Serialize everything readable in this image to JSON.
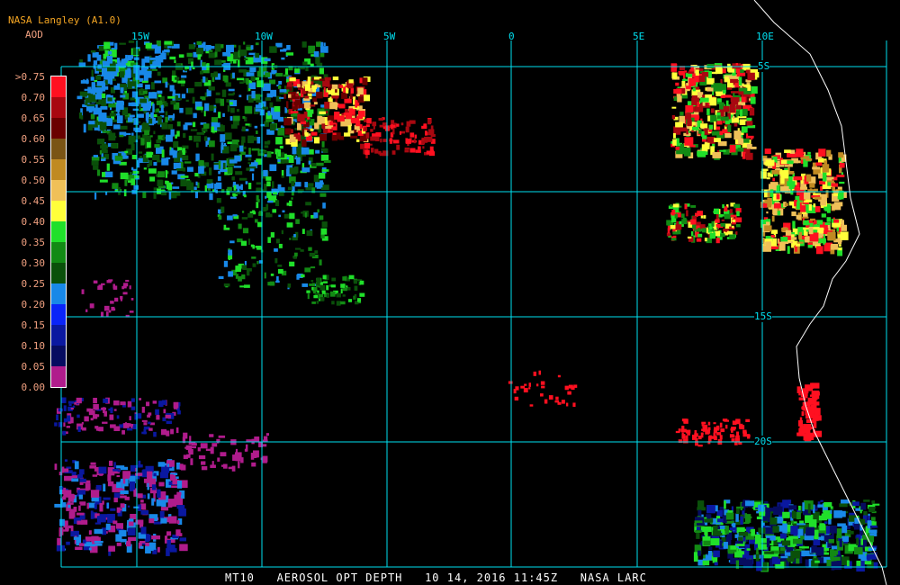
{
  "header": {
    "title": "NASA Langley (A1.0)",
    "product": "AOD"
  },
  "colorbar": {
    "labels": [
      ">0.75",
      "0.70",
      "0.65",
      "0.60",
      "0.55",
      "0.50",
      "0.45",
      "0.40",
      "0.35",
      "0.30",
      "0.25",
      "0.20",
      "0.15",
      "0.10",
      "0.05",
      "0.00"
    ],
    "colors": [
      "#ff1020",
      "#a80810",
      "#6a0000",
      "#7a5414",
      "#c08a22",
      "#f0c058",
      "#ffff3a",
      "#20e02a",
      "#128a14",
      "#0a500a",
      "#1888e8",
      "#0a24f8",
      "#0a18a0",
      "#060c60",
      "#b01c8c"
    ]
  },
  "longitudes": [
    "15W",
    "10W",
    "5W",
    "0",
    "5E",
    "10E"
  ],
  "latitudes": [
    "5S",
    "15S",
    "20S"
  ],
  "footer": "MT10   AEROSOL OPT DEPTH   10 14, 2016 11:45Z   NASA LARC",
  "colors": {
    "grid": "#00e0f0",
    "coast": "#ffffff"
  }
}
